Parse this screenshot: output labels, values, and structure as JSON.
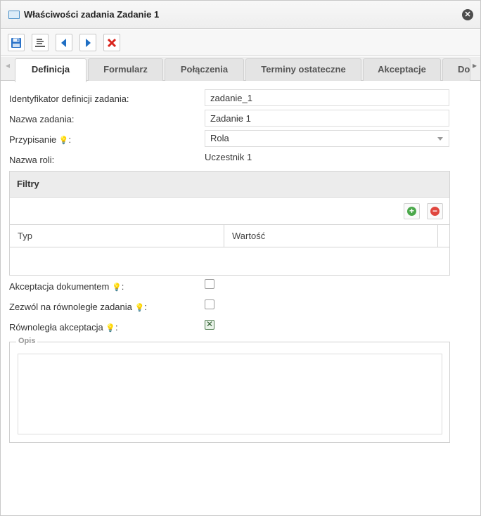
{
  "window": {
    "title": "Właściwości zadania Zadanie 1",
    "close_symbol": "✕",
    "title_icon": "window-icon"
  },
  "toolbar": {
    "buttons": [
      {
        "icon": "save-icon"
      },
      {
        "icon": "text-format-icon"
      },
      {
        "icon": "previous-arrow-icon"
      },
      {
        "icon": "next-arrow-icon"
      },
      {
        "icon": "delete-x-icon"
      }
    ]
  },
  "tabs": {
    "items": [
      {
        "label": "Definicja",
        "active": true
      },
      {
        "label": "Formularz"
      },
      {
        "label": "Połączenia"
      },
      {
        "label": "Terminy ostateczne"
      },
      {
        "label": "Akceptacje"
      },
      {
        "label": "Do"
      }
    ],
    "scroll_left": "◂",
    "scroll_right": "▸"
  },
  "form": {
    "task_def_id_label": "Identyfikator definicji zadania:",
    "task_def_id_value": "zadanie_1",
    "task_name_label": "Nazwa zadania:",
    "task_name_value": "Zadanie 1",
    "assignment_label": "Przypisanie",
    "assignment_value": "Rola",
    "role_name_label": "Nazwa roli:",
    "role_name_value": "Uczestnik 1",
    "hint_symbol": "💡",
    "colon": ":"
  },
  "filters": {
    "title": "Filtry",
    "add_symbol": "+",
    "remove_symbol": "−",
    "columns": [
      "Typ",
      "Wartość"
    ],
    "rows": []
  },
  "options": {
    "doc_acceptance_label": "Akceptacja dokumentem",
    "doc_acceptance_checked": false,
    "parallel_tasks_label": "Zezwól na równoległe zadania",
    "parallel_tasks_checked": false,
    "parallel_acceptance_label": "Równoległa akceptacja",
    "parallel_acceptance_checked": true
  },
  "description": {
    "legend": "Opis",
    "value": ""
  },
  "colors": {
    "accent_blue": "#1f6fc4",
    "delete_red": "#d9241c",
    "add_green": "#4aa84a",
    "remove_red": "#e0473f"
  }
}
